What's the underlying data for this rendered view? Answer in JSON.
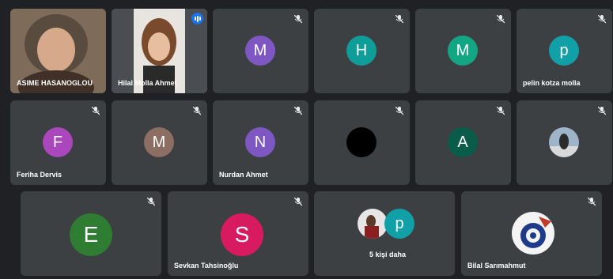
{
  "tiles": [
    {
      "name": "ASIME HASANOGLOU",
      "type": "video"
    },
    {
      "name": "Hilal Molla Ahmet",
      "type": "video",
      "speaking": true
    },
    {
      "initial": "M",
      "color": "#7e57c2",
      "muted": true
    },
    {
      "initial": "H",
      "color": "#0f9d9a",
      "muted": true
    },
    {
      "initial": "M",
      "color": "#12a685",
      "muted": true
    },
    {
      "initial": "p",
      "name": "pelin kotza molla",
      "color": "#12a0a8",
      "muted": true
    },
    {
      "initial": "F",
      "name": "Feriha Dervis",
      "color": "#ab47bc",
      "muted": true
    },
    {
      "initial": "M",
      "color": "#8d6e63",
      "muted": true
    },
    {
      "initial": "N",
      "name": "Nurdan Ahmet",
      "color": "#7e57c2",
      "muted": true
    },
    {
      "type": "black-avatar",
      "muted": true
    },
    {
      "initial": "A",
      "color": "#0a5c4a",
      "muted": true
    },
    {
      "type": "photo-avatar",
      "muted": true
    },
    {
      "initial": "E",
      "color": "#2e7d32",
      "muted": true
    },
    {
      "initial": "S",
      "name": "Sevkan Tahsinoğlu",
      "color": "#d81b60",
      "muted": true
    },
    {
      "name": "5 kişi daha",
      "type": "overflow",
      "initial": "p",
      "color": "#12a0a8"
    },
    {
      "name": "Bilal Sarımahmut",
      "type": "photo-avatar",
      "muted": true
    }
  ]
}
